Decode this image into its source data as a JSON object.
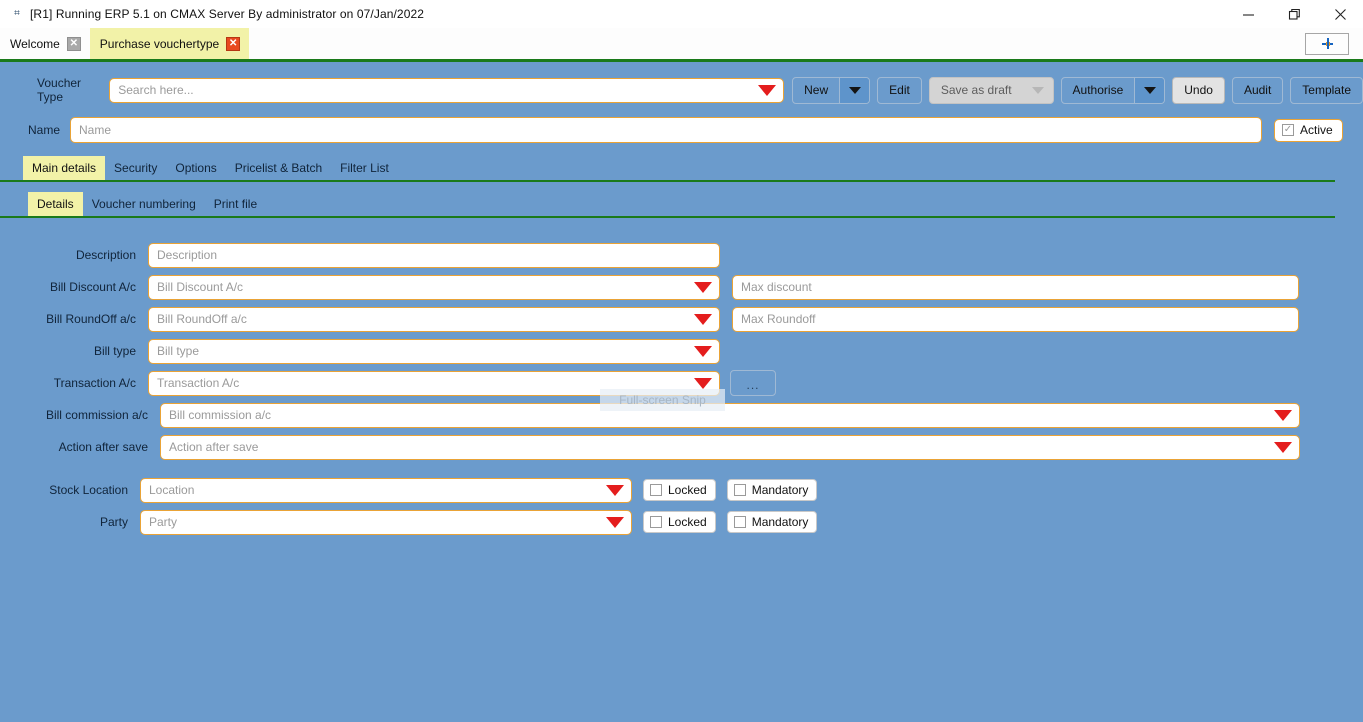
{
  "window": {
    "title": "[R1] Running ERP 5.1 on CMAX Server By administrator on 07/Jan/2022",
    "app_glyph": "⌗",
    "minimize_label": "minimize-icon",
    "restore_label": "restore-icon",
    "close_label": "close-icon"
  },
  "doc_tabs": [
    {
      "label": "Welcome",
      "close": "✕",
      "active": false
    },
    {
      "label": "Purchase vouchertype",
      "close": "✕",
      "active": true
    }
  ],
  "new_tab": {
    "label": "+"
  },
  "voucher": {
    "label": "Voucher Type",
    "placeholder": "Search here..."
  },
  "toolbar": {
    "new_label": "New",
    "edit_label": "Edit",
    "save_draft_label": "Save as draft",
    "authorise_label": "Authorise",
    "undo_label": "Undo",
    "audit_label": "Audit",
    "template_label": "Template"
  },
  "name_row": {
    "label": "Name",
    "placeholder": "Name",
    "active_label": "Active",
    "active_checked": "✓"
  },
  "main_tabs": [
    {
      "label": "Main details",
      "active": true
    },
    {
      "label": "Security",
      "active": false
    },
    {
      "label": "Options",
      "active": false
    },
    {
      "label": "Pricelist & Batch",
      "active": false
    },
    {
      "label": "Filter List",
      "active": false
    }
  ],
  "sub_tabs": [
    {
      "label": "Details",
      "active": true
    },
    {
      "label": "Voucher numbering",
      "active": false
    },
    {
      "label": "Print file",
      "active": false
    }
  ],
  "form": {
    "description": {
      "label": "Description",
      "placeholder": "Description"
    },
    "bill_discount": {
      "label": "Bill Discount A/c",
      "placeholder": "Bill Discount A/c"
    },
    "max_discount": {
      "placeholder": "Max discount"
    },
    "bill_roundoff": {
      "label": "Bill RoundOff a/c",
      "placeholder": "Bill RoundOff a/c"
    },
    "max_roundoff": {
      "placeholder": "Max Roundoff"
    },
    "bill_type": {
      "label": "Bill type",
      "placeholder": "Bill type"
    },
    "transaction": {
      "label": "Transaction A/c",
      "placeholder": "Transaction A/c",
      "button": "..."
    },
    "commission": {
      "label": "Bill commission a/c",
      "placeholder": "Bill commission a/c"
    },
    "action_save": {
      "label": "Action after save",
      "placeholder": "Action after save"
    },
    "stock_location": {
      "label": "Stock Location",
      "placeholder": "Location"
    },
    "party": {
      "label": "Party",
      "placeholder": "Party"
    },
    "locked_label": "Locked",
    "mandatory_label": "Mandatory"
  },
  "overlay": {
    "snip_label": "Full-screen Snip"
  },
  "colors": {
    "workspace_bg": "#6b9bcc",
    "field_border": "#eaa336",
    "accent_green": "#1a7a1a",
    "tab_active": "#f2f2a8",
    "caret_red": "#e41d1d",
    "close_red": "#e8491f"
  }
}
